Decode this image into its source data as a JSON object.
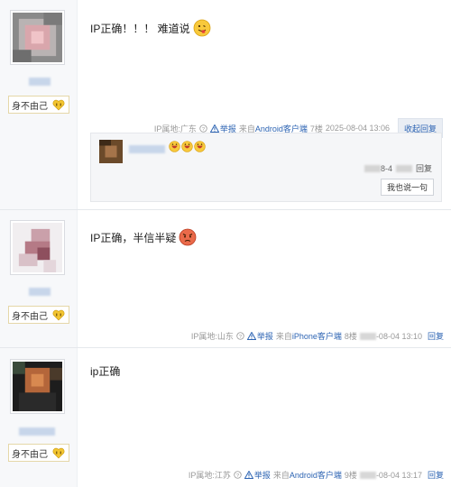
{
  "badge_label": "身不由己",
  "posts": [
    {
      "content": "IP正确！！！ 难道说",
      "meta": {
        "ip": "IP属地:广东",
        "report": "举报",
        "source_prefix": "来自",
        "source": "Android客户端",
        "floor": "7楼",
        "time": "2025-08-04 13:06"
      },
      "collapse_label": "收起回复",
      "sub_reply": {
        "date": "8-4",
        "reply_label": "回复",
        "say_button": "我也说一句"
      }
    },
    {
      "content": "IP正确，半信半疑",
      "meta": {
        "ip": "IP属地:山东",
        "report": "举报",
        "source_prefix": "来自",
        "source": "iPhone客户端",
        "floor": "8楼",
        "time": "-08-04 13:10",
        "reply": "回复"
      }
    },
    {
      "content": "ip正确",
      "meta": {
        "ip": "IP属地:江苏",
        "report": "举报",
        "source_prefix": "来自",
        "source": "Android客户端",
        "floor": "9楼",
        "time": "-08-04 13:17",
        "reply": "回复"
      }
    }
  ],
  "colors": {
    "link_blue": "#2d64b3",
    "meta_gray": "#999999",
    "left_panel": "#f7f8fa"
  },
  "icons": [
    "info-circle-icon",
    "warning-triangle-icon",
    "tongue-emoji-icon",
    "angry-emoji-icon",
    "grin-emoji-icon",
    "crying-heart-badge-icon"
  ]
}
